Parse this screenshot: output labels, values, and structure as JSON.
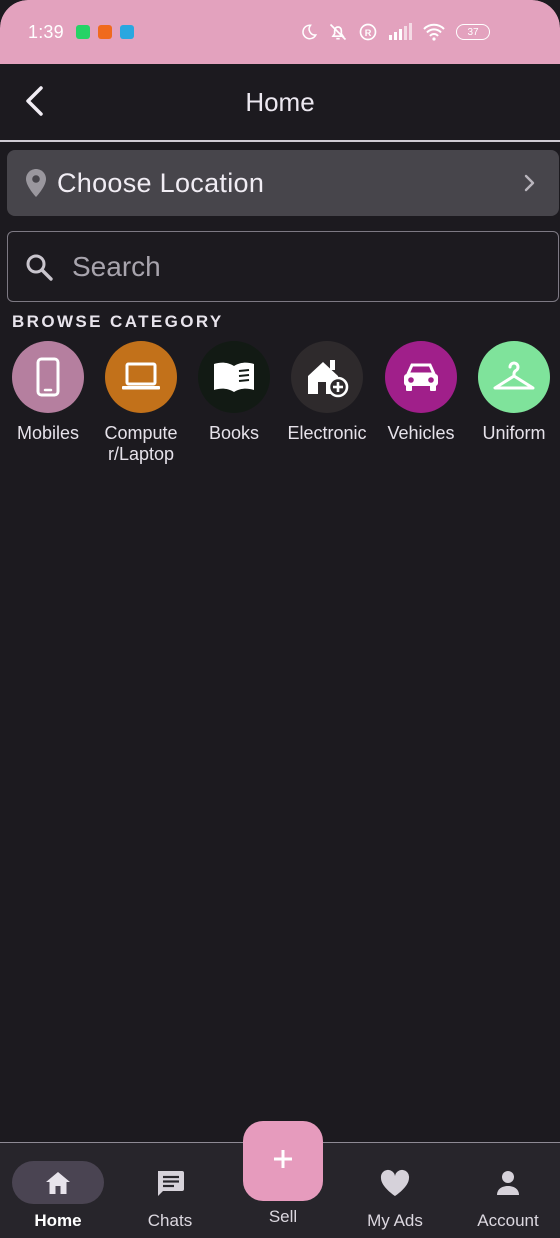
{
  "status_bar": {
    "time": "1:39",
    "battery": "37",
    "notification_colors": [
      "#25d366",
      "#f06a1e",
      "#2aa7e0"
    ]
  },
  "app_bar": {
    "title": "Home",
    "back_icon": "arrow-back-icon"
  },
  "location": {
    "label": "Choose Location",
    "icon": "location-pin-icon"
  },
  "search": {
    "placeholder": "Search",
    "icon": "search-icon"
  },
  "browse": {
    "heading": "BROWSE CATEGORY",
    "categories": [
      {
        "label": "Mobiles",
        "icon": "smartphone-icon",
        "color": "#b57f9f"
      },
      {
        "label": "Computer/Laptop",
        "icon": "laptop-icon",
        "color": "#c2711a"
      },
      {
        "label": "Books",
        "icon": "book-icon",
        "color": "#121a14"
      },
      {
        "label": "Electronic",
        "icon": "home-add-icon",
        "color": "#2e2a2c"
      },
      {
        "label": "Vehicles",
        "icon": "car-icon",
        "color": "#a01f8a"
      },
      {
        "label": "Uniform",
        "icon": "hanger-icon",
        "color": "#7fe39b"
      }
    ]
  },
  "bottom_nav": {
    "items": [
      {
        "label": "Home",
        "icon": "home-icon",
        "active": true
      },
      {
        "label": "Chats",
        "icon": "chat-icon",
        "active": false
      },
      {
        "label": "Sell",
        "icon": "plus-icon",
        "active": false
      },
      {
        "label": "My Ads",
        "icon": "heart-icon",
        "active": false
      },
      {
        "label": "Account",
        "icon": "person-icon",
        "active": false
      }
    ],
    "sell_color": "#e69bbd"
  }
}
